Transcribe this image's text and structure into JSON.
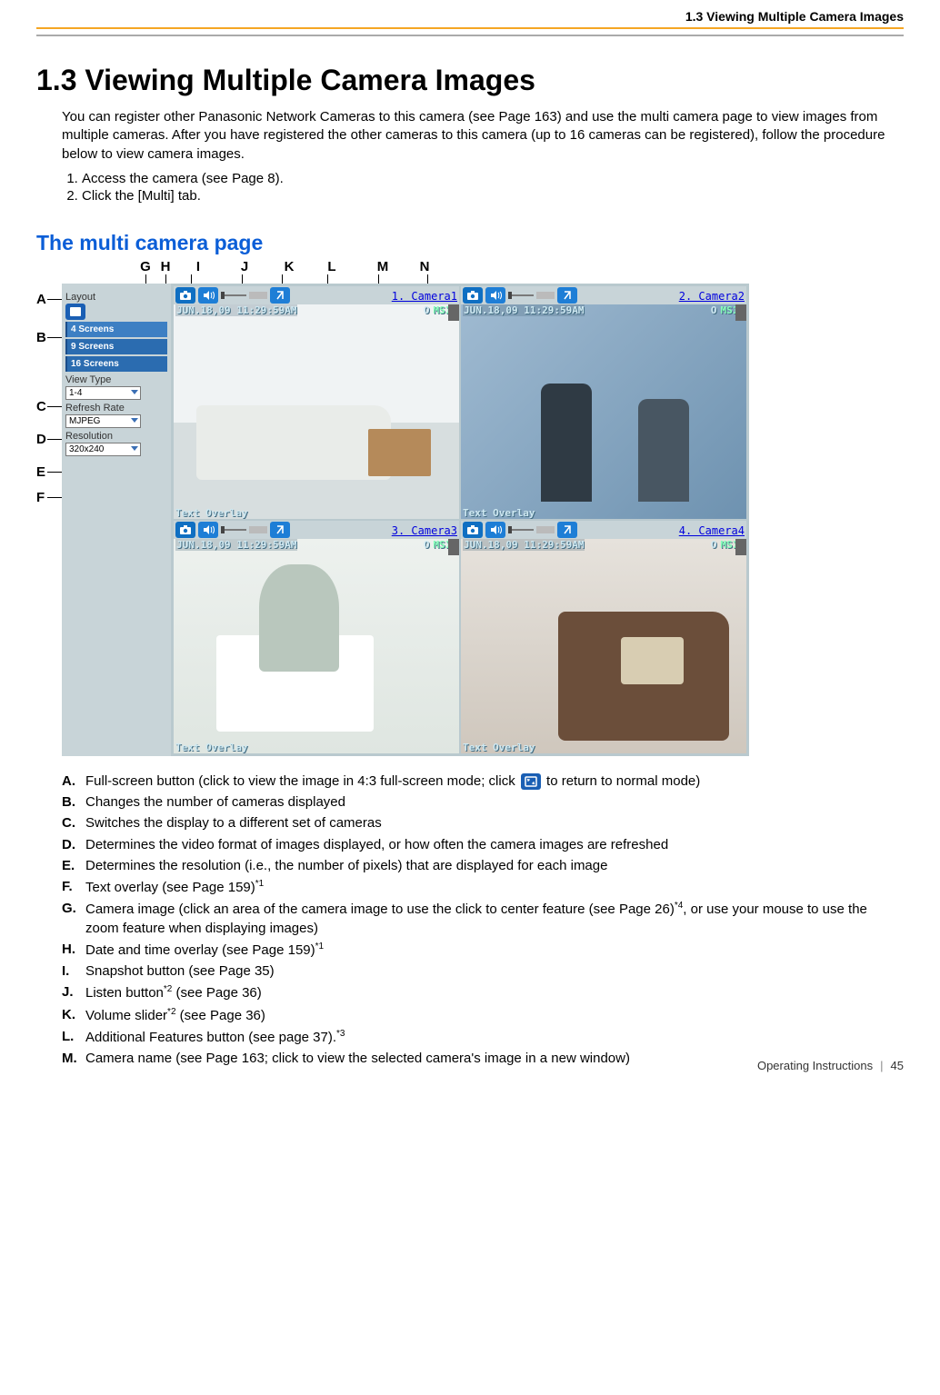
{
  "header": {
    "section": "1.3 Viewing Multiple Camera Images"
  },
  "title": "1.3  Viewing Multiple Camera Images",
  "intro": "You can register other Panasonic Network Cameras to this camera (see Page 163) and use the multi camera page to view images from multiple cameras. After you have registered the other cameras to this camera (up to 16 cameras can be registered), follow the procedure below to view camera images.",
  "steps": [
    "Access the camera (see Page 8).",
    "Click the [Multi] tab."
  ],
  "subtitle": "The multi camera page",
  "top_labels": [
    "G",
    "H",
    "I",
    "J",
    "K",
    "L",
    "M",
    "N"
  ],
  "side_labels": [
    "A",
    "B",
    "C",
    "D",
    "E",
    "F"
  ],
  "sidebar": {
    "layout_lbl": "Layout",
    "layout_buttons": [
      "4 Screens",
      "9 Screens",
      "16 Screens"
    ],
    "viewtype_lbl": "View Type",
    "viewtype_val": "1-4",
    "refresh_lbl": "Refresh Rate",
    "refresh_val": "MJPEG",
    "res_lbl": "Resolution",
    "res_val": "320x240"
  },
  "cameras": [
    {
      "name": "1. Camera1",
      "timestamp": "JUN.18,09 11:29:59AM",
      "status": "O",
      "ms": "MS12",
      "overlay": "Text Overlay"
    },
    {
      "name": "2. Camera2",
      "timestamp": "JUN.18,09 11:29:59AM",
      "status": "O",
      "ms": "MS12",
      "overlay": "Text Overlay"
    },
    {
      "name": "3. Camera3",
      "timestamp": "JUN.18,09 11:29:59AM",
      "status": "O",
      "ms": "MS12",
      "overlay": "Text Overlay"
    },
    {
      "name": "4. Camera4",
      "timestamp": "JUN.18,09 11:29:59AM",
      "status": "O",
      "ms": "MS12",
      "overlay": "Text Overlay"
    }
  ],
  "legend": {
    "A": {
      "pre": "Full-screen button (click to view the image in 4:3 full-screen mode; click ",
      "post": " to return to normal mode)"
    },
    "B": "Changes the number of cameras displayed",
    "C": "Switches the display to a different set of cameras",
    "D": "Determines the video format of images displayed, or how often the camera images are refreshed",
    "E": "Determines the resolution (i.e., the number of pixels) that are displayed for each image",
    "F": {
      "txt": "Text overlay (see Page 159)",
      "sup": "*1"
    },
    "G": {
      "txt": "Camera image (click an area of the camera image to use the click to center feature (see Page 26)",
      "sup": "*4",
      "post": ", or use your mouse to use the zoom feature when displaying images)"
    },
    "H": {
      "txt": "Date and time overlay (see Page 159)",
      "sup": "*1"
    },
    "I": "Snapshot button (see Page 35)",
    "J": {
      "txt": "Listen button",
      "sup": "*2",
      "post": " (see Page 36)"
    },
    "K": {
      "txt": "Volume slider",
      "sup": "*2",
      "post": " (see Page 36)"
    },
    "L": {
      "txt": "Additional Features button (see page 37).",
      "sup": "*3"
    },
    "M": "Camera name (see Page 163; click to view the selected camera's image in a new window)"
  },
  "footer": {
    "doc": "Operating Instructions",
    "page": "45"
  }
}
